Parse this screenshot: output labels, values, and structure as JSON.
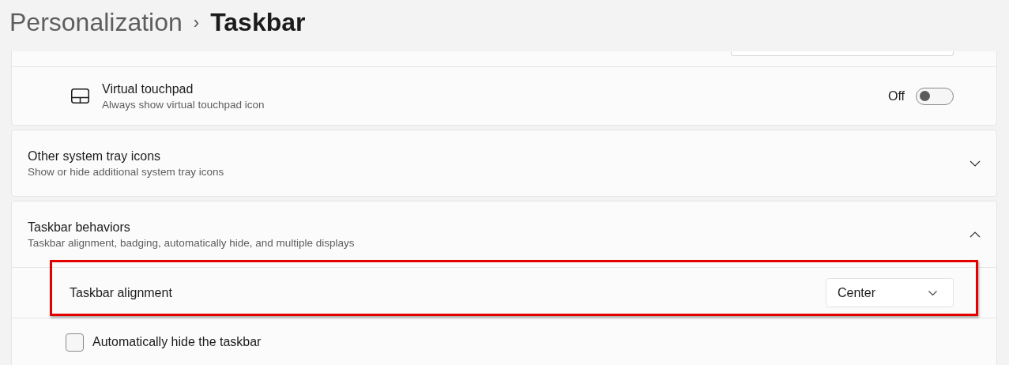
{
  "breadcrumb": {
    "parent": "Personalization",
    "separator": "›",
    "current": "Taskbar"
  },
  "virtual_touchpad": {
    "title": "Virtual touchpad",
    "subtitle": "Always show virtual touchpad icon",
    "state_label": "Off",
    "on": false
  },
  "other_system_tray_icons": {
    "title": "Other system tray icons",
    "subtitle": "Show or hide additional system tray icons",
    "expanded": false
  },
  "taskbar_behaviors": {
    "title": "Taskbar behaviors",
    "subtitle": "Taskbar alignment, badging, automatically hide, and multiple displays",
    "expanded": true,
    "alignment": {
      "label": "Taskbar alignment",
      "value": "Center",
      "highlighted": true
    },
    "auto_hide": {
      "label": "Automatically hide the taskbar",
      "checked": false
    }
  }
}
